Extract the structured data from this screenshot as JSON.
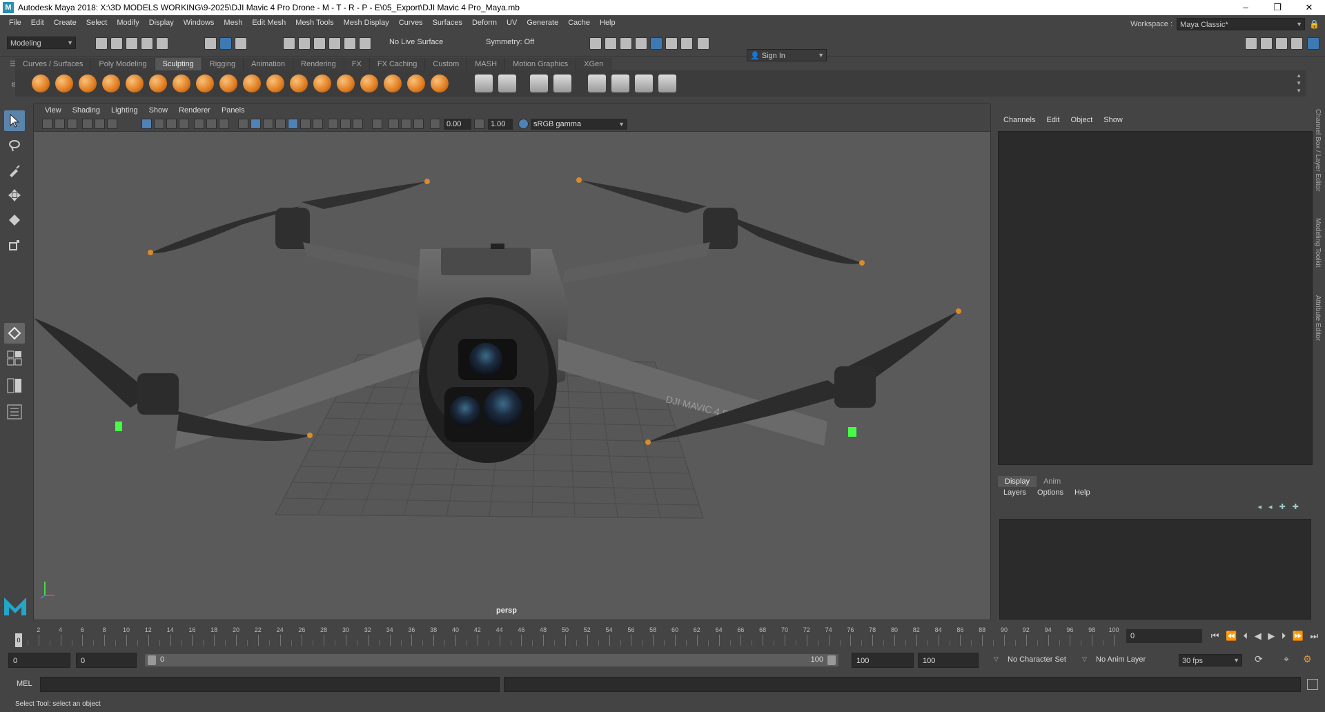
{
  "titlebar": {
    "title": "Autodesk Maya 2018: X:\\3D MODELS WORKING\\9-2025\\DJI Mavic 4 Pro Drone - M - T - R - P - E\\05_Export\\DJI Mavic 4 Pro_Maya.mb",
    "minimize": "–",
    "maximize": "❐",
    "close": "✕"
  },
  "menubar": {
    "items": [
      "File",
      "Edit",
      "Create",
      "Select",
      "Modify",
      "Display",
      "Windows",
      "Mesh",
      "Edit Mesh",
      "Mesh Tools",
      "Mesh Display",
      "Curves",
      "Surfaces",
      "Deform",
      "UV",
      "Generate",
      "Cache",
      "Help"
    ]
  },
  "workspace": {
    "label": "Workspace :",
    "value": "Maya Classic*"
  },
  "statusline": {
    "mode": "Modeling",
    "live_surface": "No Live Surface",
    "symmetry": "Symmetry: Off",
    "sign_in": "Sign In"
  },
  "shelf": {
    "tabs": [
      "Curves / Surfaces",
      "Poly Modeling",
      "Sculpting",
      "Rigging",
      "Animation",
      "Rendering",
      "FX",
      "FX Caching",
      "Custom",
      "MASH",
      "Motion Graphics",
      "XGen"
    ],
    "active_tab": "Sculpting"
  },
  "viewport": {
    "menu": [
      "View",
      "Shading",
      "Lighting",
      "Show",
      "Renderer",
      "Panels"
    ],
    "exposure": "0.00",
    "gamma": "1.00",
    "color_space": "sRGB gamma",
    "camera": "persp",
    "model_label": "DJI MAVIC 4 PRO"
  },
  "channelbox": {
    "menu": [
      "Channels",
      "Edit",
      "Object",
      "Show"
    ],
    "side_tabs": [
      "Channel Box / Layer Editor",
      "Modeling Toolkit",
      "Attribute Editor"
    ]
  },
  "layer_editor": {
    "tabs": [
      "Display",
      "Anim"
    ],
    "active_tab": "Display",
    "menu": [
      "Layers",
      "Options",
      "Help"
    ]
  },
  "timeslider": {
    "ticks": [
      "2",
      "4",
      "6",
      "8",
      "10",
      "12",
      "14",
      "16",
      "18",
      "20",
      "22",
      "24",
      "26",
      "28",
      "30",
      "32",
      "34",
      "36",
      "38",
      "40",
      "42",
      "44",
      "46",
      "48",
      "50",
      "52",
      "54",
      "56",
      "58",
      "60",
      "62",
      "64",
      "66",
      "68",
      "70",
      "72",
      "74",
      "76",
      "78",
      "80",
      "82",
      "84",
      "86",
      "88",
      "90",
      "92",
      "94",
      "96",
      "98",
      "100"
    ],
    "start_tick": "0",
    "current_frame": "0"
  },
  "range": {
    "start": "0",
    "playback_start": "0",
    "slider_start": "0",
    "slider_end": "100",
    "playback_end": "100",
    "end": "100",
    "character_set": "No Character Set",
    "anim_layer": "No Anim Layer",
    "fps": "30 fps"
  },
  "cmdline": {
    "label": "MEL"
  },
  "helpline": {
    "text": "Select Tool: select an object"
  }
}
